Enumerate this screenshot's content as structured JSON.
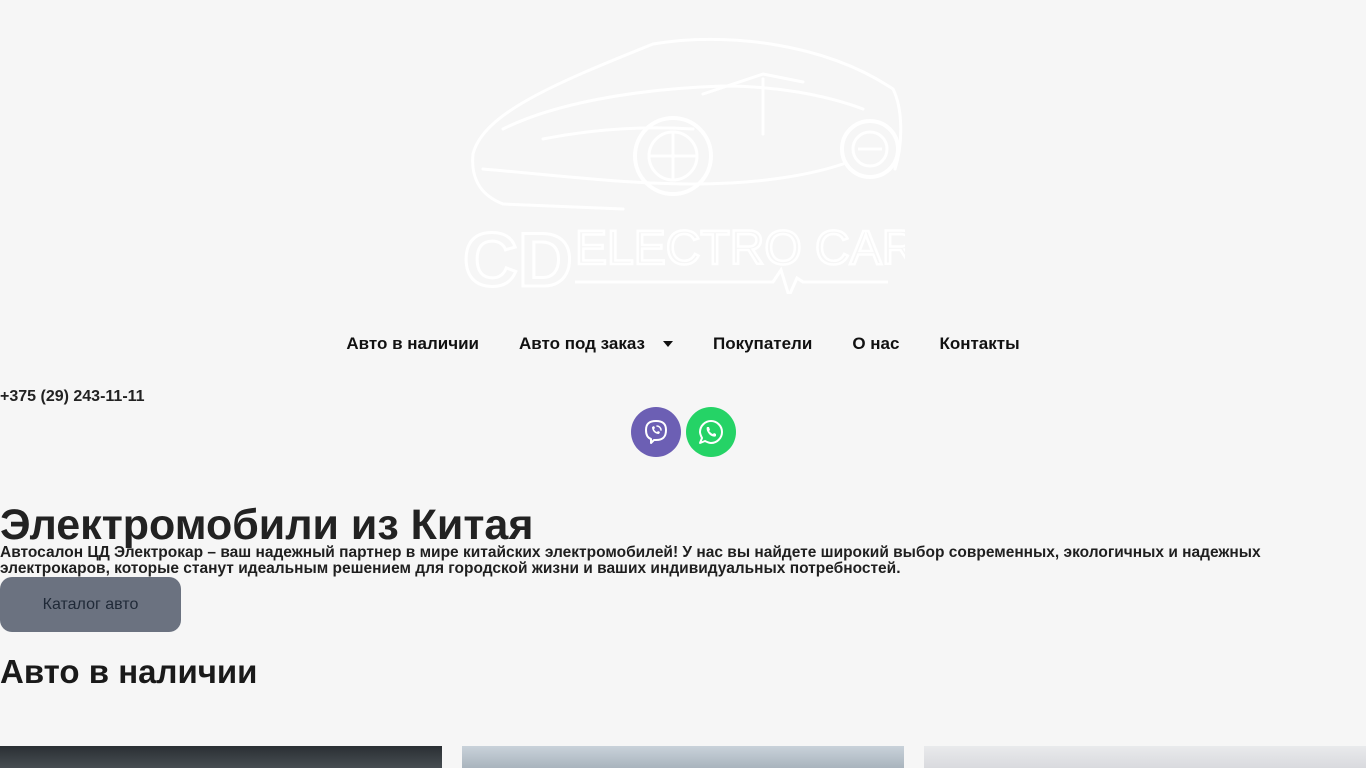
{
  "logo": {
    "text_left": "CD",
    "text_right": "ELECTRO CAR"
  },
  "nav": {
    "items": [
      {
        "label": "Авто в наличии"
      },
      {
        "label": "Авто под заказ"
      },
      {
        "label": "Покупатели"
      },
      {
        "label": "О нас"
      },
      {
        "label": "Контакты"
      }
    ]
  },
  "contacts": {
    "phone": "+375 (29) 243-11-11"
  },
  "social": [
    {
      "name": "viber",
      "icon": "viber-icon",
      "color": "#6c5fb4"
    },
    {
      "name": "whatsapp",
      "icon": "whatsapp-icon",
      "color": "#25d366"
    }
  ],
  "hero": {
    "title": "Электромобили из Китая",
    "description": "Автосалон ЦД Электрокар – ваш надежный партнер в мире китайских электромобилей! У нас вы найдете широкий выбор современных, экологичных и надежных электрокаров, которые станут идеальным решением для городской жизни и ваших индивидуальных потребностей.",
    "button_label": "Каталог авто"
  },
  "in_stock": {
    "title": "Авто в наличии"
  },
  "colors": {
    "background": "#f6f6f6",
    "button": "#6b7280"
  }
}
